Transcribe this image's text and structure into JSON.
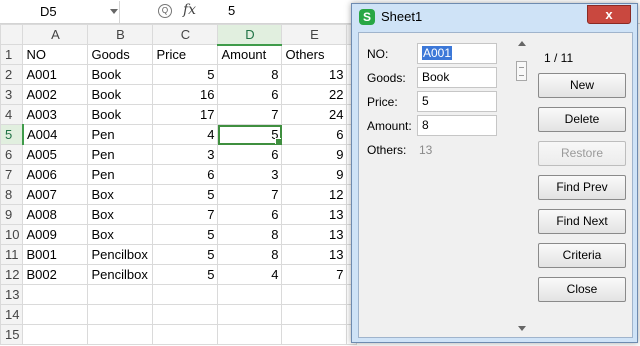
{
  "formula_bar": {
    "name_box": "D5",
    "fx_label": "fx",
    "zoom_glyph": "Q",
    "value": "5"
  },
  "grid": {
    "columns": [
      "A",
      "B",
      "C",
      "D",
      "E"
    ],
    "row_numbers": [
      "1",
      "2",
      "3",
      "4",
      "5",
      "6",
      "7",
      "8",
      "9",
      "10",
      "11",
      "12",
      "13",
      "14",
      "15"
    ],
    "rows": [
      [
        "NO",
        "Goods",
        "Price",
        "Amount",
        "Others"
      ],
      [
        "A001",
        "Book",
        "5",
        "8",
        "13"
      ],
      [
        "A002",
        "Book",
        "16",
        "6",
        "22"
      ],
      [
        "A003",
        "Book",
        "17",
        "7",
        "24"
      ],
      [
        "A004",
        "Pen",
        "4",
        "5",
        "6"
      ],
      [
        "A005",
        "Pen",
        "3",
        "6",
        "9"
      ],
      [
        "A006",
        "Pen",
        "6",
        "3",
        "9"
      ],
      [
        "A007",
        "Box",
        "5",
        "7",
        "12"
      ],
      [
        "A008",
        "Box",
        "7",
        "6",
        "13"
      ],
      [
        "A009",
        "Box",
        "5",
        "8",
        "13"
      ],
      [
        "B001",
        "Pencilbox",
        "5",
        "8",
        "13"
      ],
      [
        "B002",
        "Pencilbox",
        "5",
        "4",
        "7"
      ],
      [
        "",
        "",
        "",
        "",
        ""
      ],
      [
        "",
        "",
        "",
        "",
        ""
      ],
      [
        "",
        "",
        "",
        "",
        ""
      ]
    ]
  },
  "dialog": {
    "title": "Sheet1",
    "app_icon": "S",
    "close_glyph": "x",
    "fields": [
      {
        "label": "NO:",
        "value": "A001"
      },
      {
        "label": "Goods:",
        "value": "Book"
      },
      {
        "label": "Price:",
        "value": "5"
      },
      {
        "label": "Amount:",
        "value": "8"
      }
    ],
    "others_label": "Others:",
    "others_value": "13",
    "record_counter": "1 / 11",
    "buttons": {
      "new": "New",
      "delete": "Delete",
      "restore": "Restore",
      "find_prev": "Find Prev",
      "find_next": "Find Next",
      "criteria": "Criteria",
      "close": "Close"
    }
  },
  "colors": {
    "selection": "#3f8f3f",
    "dialog_bg": "#cfe3f7",
    "close_button": "#c9483f",
    "input_highlight": "#3c78d8"
  },
  "icons": [
    "zoom-icon",
    "fx-icon",
    "app-icon",
    "close-icon",
    "scroll-up-icon",
    "scroll-down-icon"
  ]
}
